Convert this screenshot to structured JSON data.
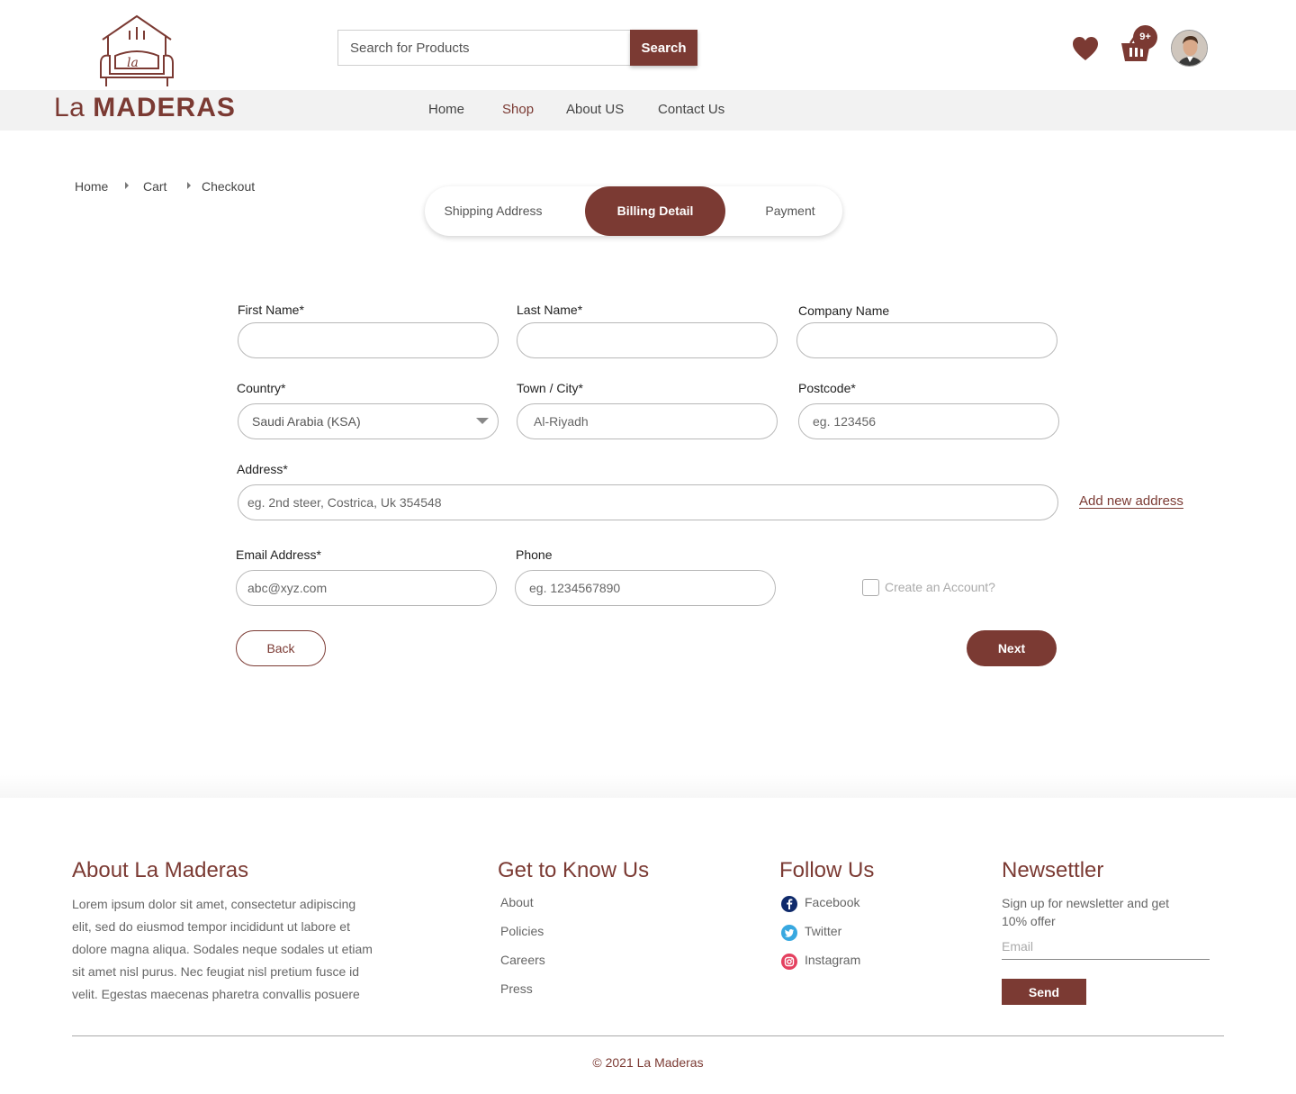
{
  "brand": {
    "name_light": "La",
    "name_bold": "MADERAS",
    "logo_mark_text": "la",
    "color": "#7b3a33"
  },
  "search": {
    "placeholder": "Search for Products",
    "button_label": "Search"
  },
  "header_icons": {
    "wishlist_icon": "heart-icon",
    "cart_icon": "basket-icon",
    "cart_badge": "9+",
    "avatar": "user-avatar"
  },
  "nav": {
    "items": [
      {
        "label": "Home",
        "active": false
      },
      {
        "label": "Shop",
        "active": true
      },
      {
        "label": "About US",
        "active": false
      },
      {
        "label": "Contact Us",
        "active": false
      }
    ]
  },
  "breadcrumb": {
    "items": [
      "Home",
      "Cart",
      "Checkout"
    ]
  },
  "steps": {
    "items": [
      {
        "label": "Shipping Address",
        "active": false
      },
      {
        "label": "Billing Detail",
        "active": true
      },
      {
        "label": "Payment",
        "active": false
      }
    ]
  },
  "form": {
    "first_name": {
      "label": "First Name*",
      "value": "",
      "placeholder": ""
    },
    "last_name": {
      "label": "Last Name*",
      "value": "",
      "placeholder": ""
    },
    "company": {
      "label": "Company Name",
      "value": "",
      "placeholder": ""
    },
    "country": {
      "label": "Country*",
      "value": "Saudi Arabia (KSA)"
    },
    "city": {
      "label": "Town / City*",
      "placeholder": "Al-Riyadh"
    },
    "postcode": {
      "label": "Postcode*",
      "placeholder": "eg. 123456"
    },
    "address": {
      "label": "Address*",
      "placeholder": "eg. 2nd steer, Costrica, Uk 354548"
    },
    "add_address_link": "Add new address",
    "email": {
      "label": "Email Address*",
      "placeholder": "abc@xyz.com"
    },
    "phone": {
      "label": "Phone",
      "placeholder": "eg. 1234567890"
    },
    "create_account": {
      "label": "Create an Account?",
      "checked": false
    },
    "back_label": "Back",
    "next_label": "Next"
  },
  "footer": {
    "about": {
      "title": "About La Maderas",
      "text": "Lorem ipsum dolor sit amet, consectetur adipiscing elit, sed do eiusmod tempor incididunt ut labore et dolore magna aliqua. Sodales neque sodales ut etiam sit amet nisl purus. Nec feugiat nisl pretium fusce id velit. Egestas maecenas pharetra convallis posuere"
    },
    "know": {
      "title": "Get to Know Us",
      "links": [
        "About",
        "Policies",
        "Careers",
        "Press"
      ]
    },
    "follow": {
      "title": "Follow Us",
      "links": [
        {
          "label": "Facebook",
          "icon": "facebook-icon",
          "color": "#0f2a6b"
        },
        {
          "label": "Twitter",
          "icon": "twitter-icon",
          "color": "#38a8e0"
        },
        {
          "label": "Instagram",
          "icon": "instagram-icon",
          "color": "#e4405f"
        }
      ]
    },
    "newsletter": {
      "title": "Newsettler",
      "text": "Sign up for newsletter and get 10% offer",
      "placeholder": "Email",
      "button_label": "Send"
    },
    "copyright": "© 2021 La Maderas"
  }
}
